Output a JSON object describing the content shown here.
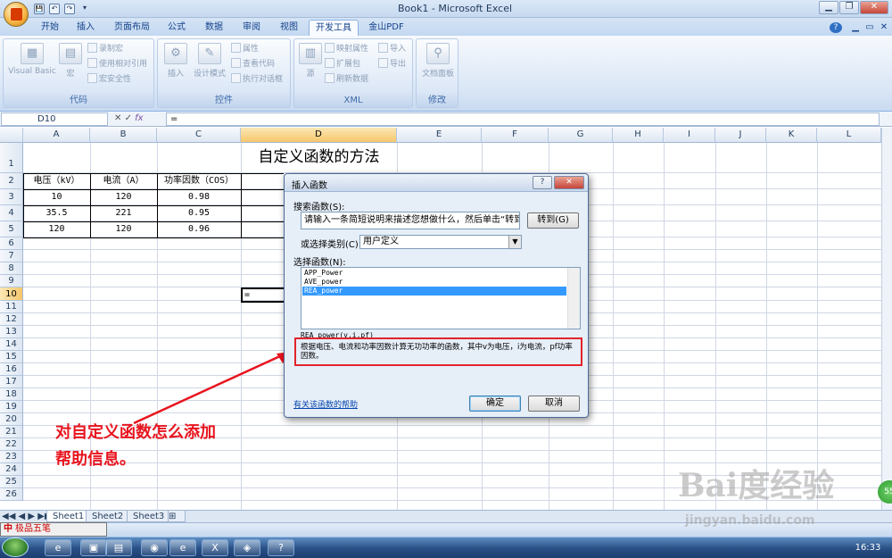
{
  "window": {
    "title": "Book1 - Microsoft Excel",
    "min": "▁",
    "max": "❐",
    "close": "✕",
    "help": "?",
    "restore": "▭"
  },
  "qat": {
    "save": "💾",
    "undo": "↶",
    "redo": "↷",
    "more": "▾"
  },
  "ribbon_tabs": [
    "开始",
    "插入",
    "页面布局",
    "公式",
    "数据",
    "审阅",
    "视图",
    "开发工具",
    "金山PDF"
  ],
  "active_tab": "开发工具",
  "groups": {
    "code": {
      "label": "代码",
      "visual_basic": "Visual Basic",
      "macros": "宏",
      "record_macro": "录制宏",
      "relative_ref": "使用相对引用",
      "macro_security": "宏安全性"
    },
    "controls": {
      "label": "控件",
      "insert": "插入",
      "design_mode": "设计模式",
      "properties": "属性",
      "view_code": "查看代码",
      "run_dialog": "执行对话框"
    },
    "xml": {
      "label": "XML",
      "source": "源",
      "map_props": "映射属性",
      "expansion": "扩展包",
      "refresh": "刷新数据",
      "import": "导入",
      "export": "导出"
    },
    "modify": {
      "label": "修改",
      "doc_panel": "文档面板"
    }
  },
  "formula_bar": {
    "name_box": "D10",
    "fx": "fx",
    "formula": "="
  },
  "columns": [
    "A",
    "B",
    "C",
    "D",
    "E",
    "F",
    "G",
    "H",
    "I",
    "J",
    "K",
    "L"
  ],
  "rows": [
    "1",
    "2",
    "3",
    "4",
    "5",
    "6",
    "7",
    "8",
    "9",
    "10",
    "11",
    "12",
    "13",
    "14",
    "15",
    "16",
    "17",
    "18",
    "19",
    "20",
    "21",
    "22",
    "23",
    "24",
    "25",
    "26"
  ],
  "sheet": {
    "title": "自定义函数的方法",
    "headers": [
      "电压（kV）",
      "电流（A）",
      "功率因数（COS）"
    ],
    "data": [
      [
        "10",
        "120",
        "0.98"
      ],
      [
        "35.5",
        "221",
        "0.95"
      ],
      [
        "120",
        "120",
        "0.96"
      ]
    ],
    "d10": "="
  },
  "sheet_tabs": [
    "Sheet1",
    "Sheet2",
    "Sheet3"
  ],
  "ime": {
    "name": "极品五笔",
    "mode": "中"
  },
  "dialog": {
    "title": "插入函数",
    "help_btn": "?",
    "close_btn": "✕",
    "search_label": "搜索函数(S):",
    "search_text": "请输入一条简短说明来描述您想做什么，然后单击“转到”",
    "go_btn": "转到(G)",
    "category_label": "或选择类别(C):",
    "category_value": "用户定义",
    "select_label": "选择函数(N):",
    "functions": [
      "APP_Power",
      "AVE_power",
      "REA_power"
    ],
    "selected_function": "REA_power",
    "signature": "REA_power(v,i,pf)",
    "description": "根据电压、电流和功率因数计算无功功率的函数，其中v为电压，i为电流，pf功率因数。",
    "help_link": "有关该函数的帮助",
    "ok": "确定",
    "cancel": "取消"
  },
  "annotation": [
    "对自定义函数怎么添加",
    "帮助信息。"
  ],
  "annotation_color": "#e8141e",
  "watermark": {
    "main": "Bai度经验",
    "url": "jingyan.baidu.com"
  },
  "badge": "55",
  "clock": "16:33"
}
